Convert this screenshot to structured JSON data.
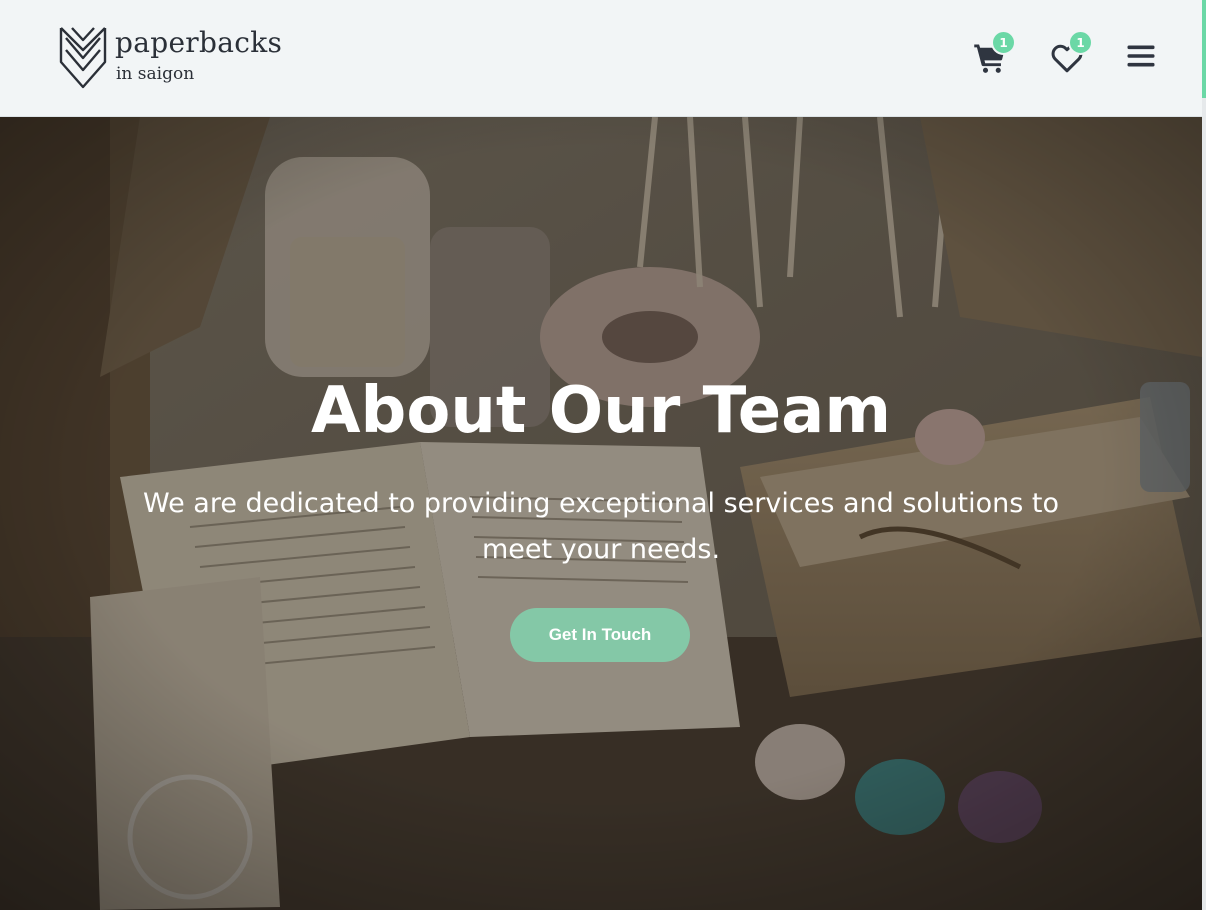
{
  "header": {
    "logo": {
      "name": "paperbacks",
      "tagline": "in saigon",
      "icon": "book-chevron-logo"
    },
    "cart": {
      "icon": "cart-icon",
      "count": "1"
    },
    "wishlist": {
      "icon": "heart-icon",
      "count": "1"
    },
    "menu": {
      "icon": "hamburger-menu-icon"
    }
  },
  "hero": {
    "title": "About Our Team",
    "subtitle": "We are dedicated to providing exceptional services and solutions to meet your needs.",
    "cta_label": "Get In Touch"
  },
  "colors": {
    "accent": "#6bd8a6",
    "cta": "#84c8a7",
    "header_bg": "#f2f5f6",
    "text_dark": "#2b3038"
  }
}
